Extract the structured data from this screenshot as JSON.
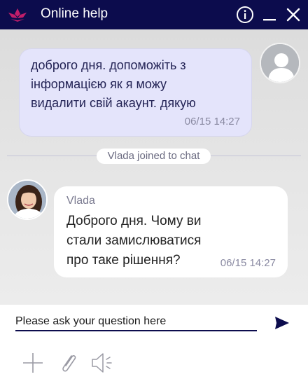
{
  "header": {
    "title": "Online help",
    "logo_icon": "lotus-logo-icon",
    "info_icon": "info-icon",
    "minimize_icon": "minimize-icon",
    "close_icon": "close-icon",
    "background_color": "#0c0c4d",
    "logo_color": "#c21e6a"
  },
  "messages": [
    {
      "sender": "user",
      "lines": [
        "доброго дня. допоможіть з",
        "інформацією як я можу",
        "видалити свій акаунт. дякую"
      ],
      "time": "06/15 14:27",
      "avatar_icon": "user-silhouette-icon"
    },
    {
      "sender": "agent",
      "name": "Vlada",
      "text": "Доброго дня. Чому ви стали замислюватися про таке рішення?",
      "time": "06/15 14:27",
      "avatar_icon": "agent-photo"
    }
  ],
  "system_notice": "Vlada joined to chat",
  "composer": {
    "placeholder": "Please ask your question here",
    "value": "",
    "send_icon": "send-icon",
    "tools": [
      "plus-icon",
      "paperclip-icon",
      "speaker-icon"
    ]
  },
  "colors": {
    "user_bubble": "#e4e4fb",
    "agent_bubble": "#ffffff",
    "accent": "#0c0c4d"
  }
}
